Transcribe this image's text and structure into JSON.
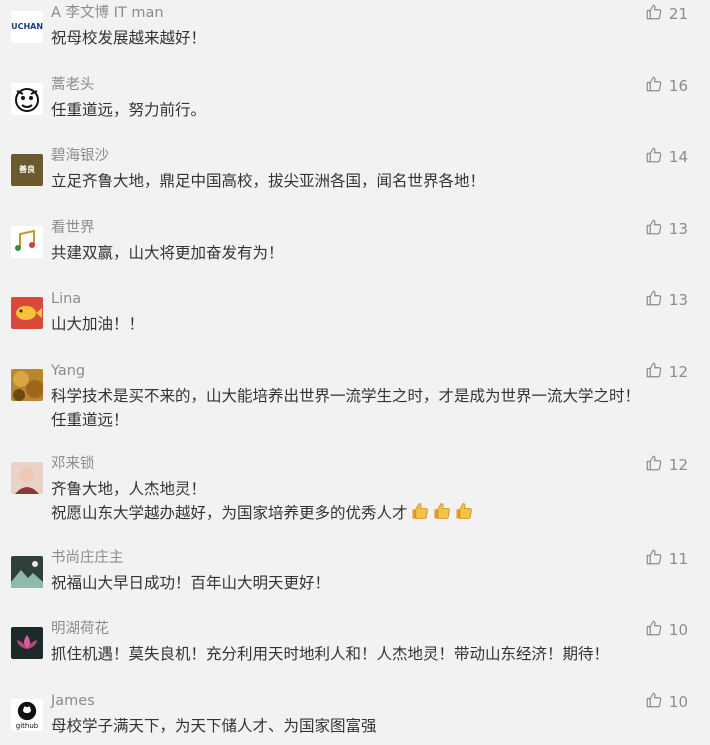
{
  "colors": {
    "background": "#f2f2f2",
    "nickname": "#8c8c8c",
    "comment_text": "#333333",
    "like_icon": "#8c8c8c"
  },
  "comments": [
    {
      "nickname": "A 李文博 IT man",
      "lines": [
        "祝母校发展越来越好！"
      ],
      "likes": "21",
      "avatar": {
        "bg": "#ffffff",
        "fg": "#1b3a8a",
        "text": "NUCHANG",
        "icon": "logo-avatar-icon"
      }
    },
    {
      "nickname": "蒿老头",
      "lines": [
        "任重道远，努力前行。"
      ],
      "likes": "16",
      "avatar": {
        "bg": "#ffffff",
        "fg": "#111111",
        "text": "",
        "icon": "cartoon-face-avatar-icon"
      }
    },
    {
      "nickname": "碧海银沙",
      "lines": [
        "立足齐鲁大地，鼎足中国高校，拔尖亚洲各国，闻名世界各地！"
      ],
      "likes": "14",
      "avatar": {
        "bg": "#6b5a2e",
        "fg": "#ffffff",
        "text": "善良",
        "icon": "text-badge-avatar-icon"
      }
    },
    {
      "nickname": "看世界",
      "lines": [
        "共建双赢，山大将更加奋发有为！"
      ],
      "likes": "13",
      "avatar": {
        "bg": "#ffffff",
        "fg": "#c49a2a",
        "text": "",
        "icon": "music-notes-avatar-icon"
      }
    },
    {
      "nickname": "Lina",
      "lines": [
        "山大加油！！"
      ],
      "likes": "13",
      "avatar": {
        "bg": "#d94a3a",
        "fg": "#f5c23a",
        "text": "",
        "icon": "fish-avatar-icon"
      }
    },
    {
      "nickname": "Yang",
      "lines": [
        "科学技术是买不来的，山大能培养出世界一流学生之时，才是成为世界一流大学之时！",
        "任重道远！"
      ],
      "likes": "12",
      "avatar": {
        "bg": "#b8862e",
        "fg": "#6b4a12",
        "text": "",
        "icon": "autumn-leaves-avatar-icon"
      }
    },
    {
      "nickname": "邓来锁",
      "lines": [
        "齐鲁大地，人杰地灵！",
        "祝愿山东大学越办越好，为国家培养更多的优秀人才"
      ],
      "likes": "12",
      "thumbs_after_last_line": 3,
      "avatar": {
        "bg": "#e9d3c8",
        "fg": "#8a3a3a",
        "text": "",
        "icon": "person-photo-avatar-icon"
      }
    },
    {
      "nickname": "书尚庄庄主",
      "lines": [
        "祝福山大早日成功！百年山大明天更好！"
      ],
      "likes": "11",
      "avatar": {
        "bg": "#2f3f3a",
        "fg": "#8fb9a8",
        "text": "",
        "icon": "landscape-avatar-icon"
      }
    },
    {
      "nickname": "明湖荷花",
      "lines": [
        "抓住机遇！莫失良机！充分利用天时地利人和！人杰地灵！带动山东经济！期待！"
      ],
      "likes": "10",
      "avatar": {
        "bg": "#1e2a2a",
        "fg": "#d65f9a",
        "text": "",
        "icon": "lotus-avatar-icon"
      }
    },
    {
      "nickname": "James",
      "lines": [
        "母校学子满天下，为天下储人才、为国家图富强"
      ],
      "likes": "10",
      "avatar": {
        "bg": "#ffffff",
        "fg": "#111111",
        "text": "github",
        "icon": "github-avatar-icon"
      }
    }
  ]
}
